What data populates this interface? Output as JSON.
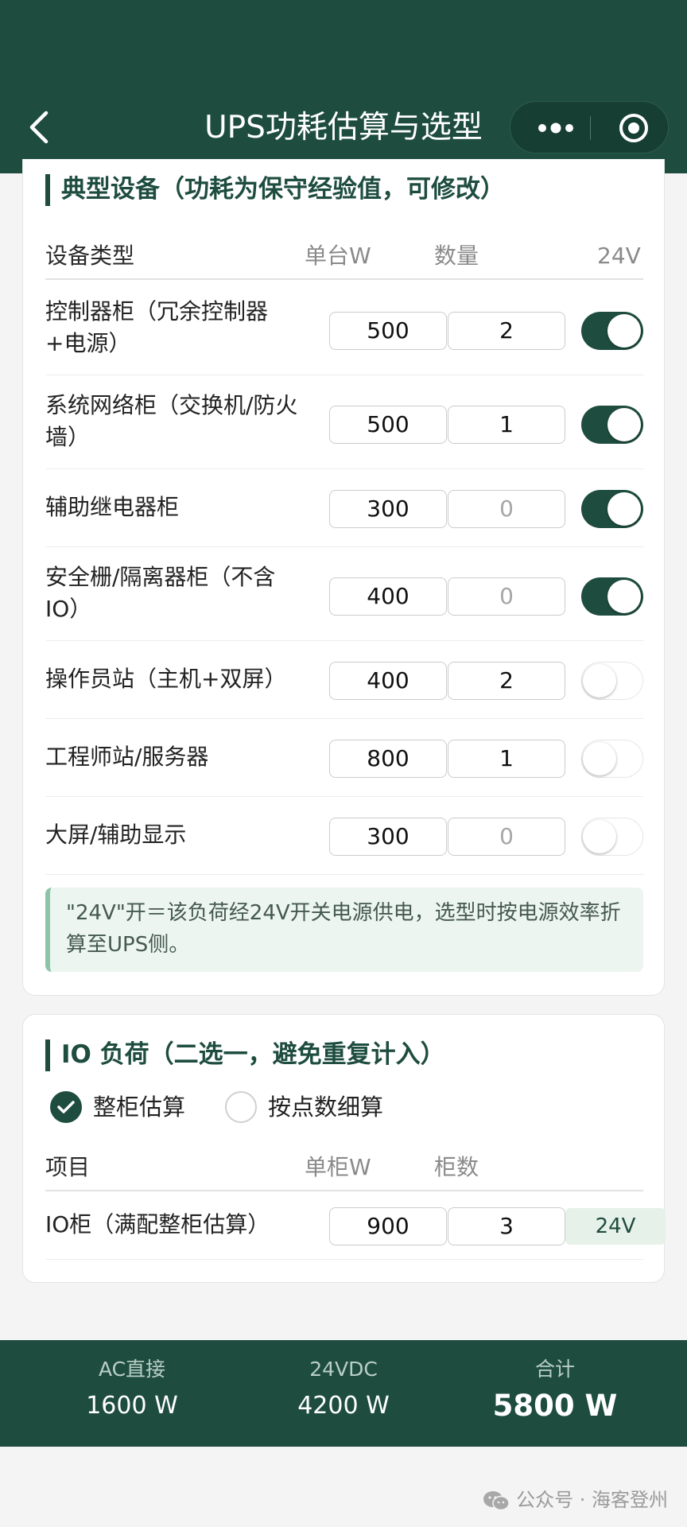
{
  "header": {
    "title": "UPS功耗估算与选型"
  },
  "typical": {
    "section_title": "典型设备（功耗为保守经验值，可修改）",
    "columns": [
      "设备类型",
      "单台W",
      "数量",
      "24V"
    ],
    "rows": [
      {
        "name": "控制器柜（冗余控制器+电源）",
        "watt": "500",
        "qty": "2",
        "qty_muted": false,
        "v24": true
      },
      {
        "name": "系统网络柜（交换机/防火墙）",
        "watt": "500",
        "qty": "1",
        "qty_muted": false,
        "v24": true
      },
      {
        "name": "辅助继电器柜",
        "watt": "300",
        "qty": "0",
        "qty_muted": true,
        "v24": true
      },
      {
        "name": "安全栅/隔离器柜（不含IO）",
        "watt": "400",
        "qty": "0",
        "qty_muted": true,
        "v24": true
      },
      {
        "name": "操作员站（主机+双屏）",
        "watt": "400",
        "qty": "2",
        "qty_muted": false,
        "v24": false
      },
      {
        "name": "工程师站/服务器",
        "watt": "800",
        "qty": "1",
        "qty_muted": false,
        "v24": false
      },
      {
        "name": "大屏/辅助显示",
        "watt": "300",
        "qty": "0",
        "qty_muted": true,
        "v24": false
      }
    ],
    "note": "\"24V\"开＝该负荷经24V开关电源供电，选型时按电源效率折算至UPS侧。"
  },
  "io": {
    "section_title": "IO 负荷（二选一，避免重复计入）",
    "options": [
      {
        "label": "整柜估算",
        "checked": true
      },
      {
        "label": "按点数细算",
        "checked": false
      }
    ],
    "columns": [
      "项目",
      "单柜W",
      "柜数"
    ],
    "row": {
      "name": "IO柜（满配整柜估算）",
      "watt": "900",
      "count": "3",
      "tag": "24V"
    }
  },
  "summary": [
    {
      "label": "AC直接",
      "value": "1600 W"
    },
    {
      "label": "24VDC",
      "value": "4200 W"
    },
    {
      "label": "合计",
      "value": "5800 W"
    }
  ],
  "watermark": "公众号 · 海客登州",
  "colors": {
    "primary": "#1e4d3f",
    "note_bg": "#edf5f0",
    "note_border": "#8cc4a8"
  }
}
